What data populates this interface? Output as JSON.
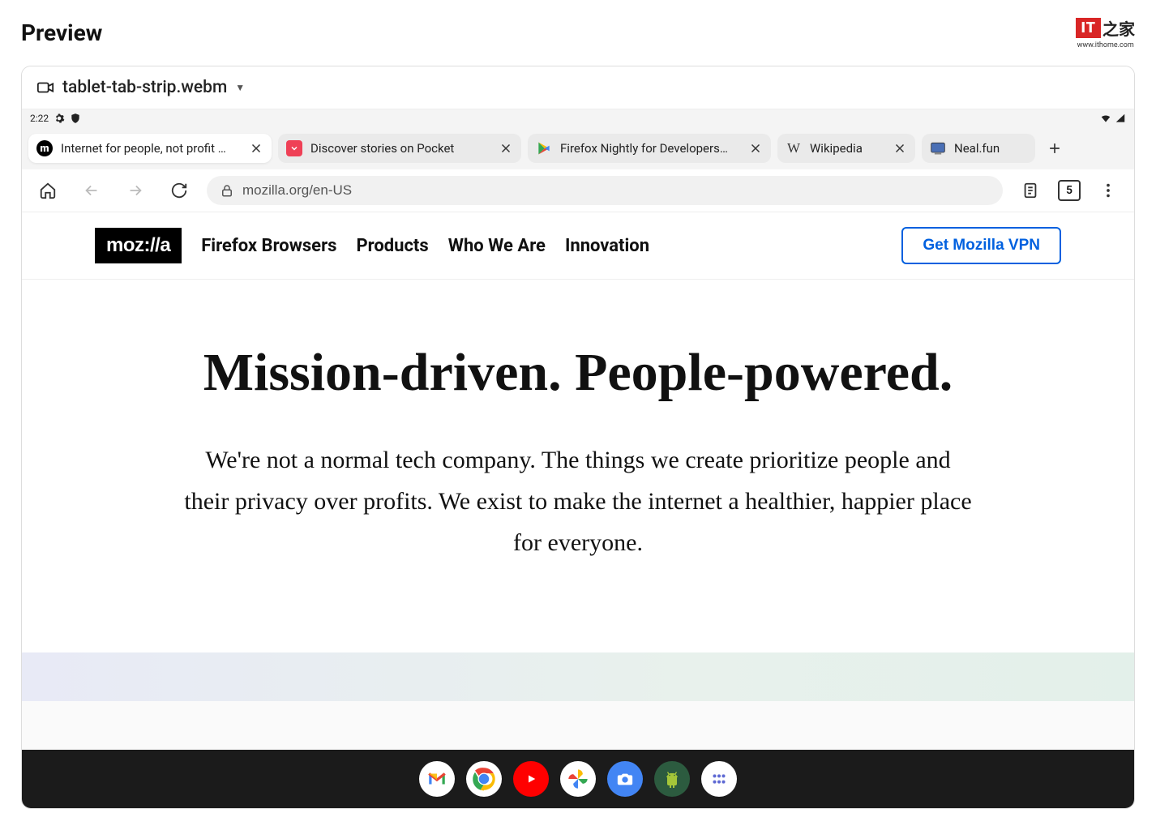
{
  "preview": {
    "title": "Preview",
    "watermark_url": "www.ithome.com",
    "filename": "tablet-tab-strip.webm"
  },
  "statusbar": {
    "time": "2:22"
  },
  "tabs": [
    {
      "label": "Internet for people, not profit …",
      "active": true,
      "icon": "mozilla",
      "closeable": true
    },
    {
      "label": "Discover stories on Pocket",
      "active": false,
      "icon": "pocket",
      "closeable": true
    },
    {
      "label": "Firefox Nightly for Developers…",
      "active": false,
      "icon": "play",
      "closeable": true
    },
    {
      "label": "Wikipedia",
      "active": false,
      "icon": "wikipedia",
      "closeable": true
    },
    {
      "label": "Neal.fun",
      "active": false,
      "icon": "neal",
      "closeable": false
    }
  ],
  "urlbar": {
    "url": "mozilla.org/en-US",
    "tab_count": "5"
  },
  "mozilla_nav": {
    "logo": "moz://a",
    "links": [
      "Firefox Browsers",
      "Products",
      "Who We Are",
      "Innovation"
    ],
    "cta": "Get Mozilla VPN"
  },
  "hero": {
    "heading": "Mission-driven. People-powered.",
    "body": "We're not a normal tech company. The things we create prioritize people and their privacy over profits. We exist to make the internet a healthier, happier place for everyone."
  },
  "shelf": {
    "apps": [
      "gmail",
      "chrome",
      "youtube",
      "photos",
      "camera",
      "android",
      "apps"
    ]
  }
}
